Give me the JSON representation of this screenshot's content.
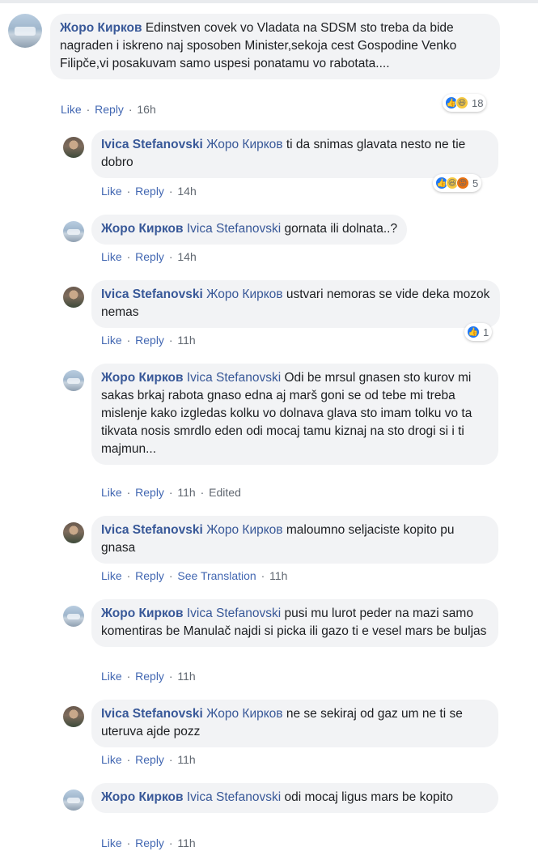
{
  "comments": [
    {
      "author": "Жоро Кирков",
      "mention": "",
      "text": "Edinstven covek vo Vladata na SDSM sto treba da bide nagraden i iskreno naj sposoben Minister,sekoja cest Gospodine Venko Filipče,vi posakuvam samo uspesi ponatamu vo rabotata....",
      "like": "Like",
      "reply": "Reply",
      "time": "16h",
      "reactions": {
        "icons": [
          "like-icon",
          "haha-icon"
        ],
        "count": "18"
      }
    },
    {
      "author": "Ivica Stefanovski",
      "mention": "Жоро Кирков",
      "text": "ti da snimas glavata nesto ne tie dobro",
      "like": "Like",
      "reply": "Reply",
      "time": "14h",
      "reactions": {
        "icons": [
          "like-icon",
          "haha-icon",
          "angry-icon"
        ],
        "count": "5"
      }
    },
    {
      "author": "Жоро Кирков",
      "mention": "Ivica Stefanovski",
      "text": "gornata ili dolnata..?",
      "like": "Like",
      "reply": "Reply",
      "time": "14h"
    },
    {
      "author": "Ivica Stefanovski",
      "mention": "Жоро Кирков",
      "text": "ustvari nemoras se vide deka mozok nemas",
      "like": "Like",
      "reply": "Reply",
      "time": "11h",
      "reactions": {
        "icons": [
          "like-icon"
        ],
        "count": "1"
      }
    },
    {
      "author": "Жоро Кирков",
      "mention": "Ivica Stefanovski",
      "text": "Odi be mrsul gnasen sto kurov mi sakas brkaj rabota gnaso edna aj marš goni se od tebe mi treba mislenje kako izgledas kolku vo dolnava glava sto imam tolku vo ta tikvata nosis smrdlo eden odi mocaj tamu kiznaj na sto drogi si i ti majmun...",
      "like": "Like",
      "reply": "Reply",
      "time": "11h",
      "edited": "Edited"
    },
    {
      "author": "Ivica Stefanovski",
      "mention": "Жоро Кирков",
      "text": "maloumno seljaciste kopito pu gnasa",
      "like": "Like",
      "reply": "Reply",
      "see_translation": "See Translation",
      "time": "11h"
    },
    {
      "author": "Жоро Кирков",
      "mention": "Ivica Stefanovski",
      "text": "pusi mu lurot peder na mazi samo komentiras be Manulač najdi si picka ili gazo ti e vesel mars be buljas",
      "like": "Like",
      "reply": "Reply",
      "time": "11h"
    },
    {
      "author": "Ivica Stefanovski",
      "mention": "Жоро Кирков",
      "text": "ne se sekiraj od gaz um ne ti se uteruva ajde pozz",
      "like": "Like",
      "reply": "Reply",
      "time": "11h"
    },
    {
      "author": "Жоро Кирков",
      "mention": "Ivica Stefanovski",
      "text": "odi mocaj ligus mars be kopito",
      "like": "Like",
      "reply": "Reply",
      "time": "11h"
    }
  ],
  "colors": {
    "author": "#385898",
    "action_link": "#4267b2",
    "bubble": "#f2f3f5",
    "like": "#2078f4",
    "haha": "#f7c940",
    "angry": "#e9710f"
  }
}
